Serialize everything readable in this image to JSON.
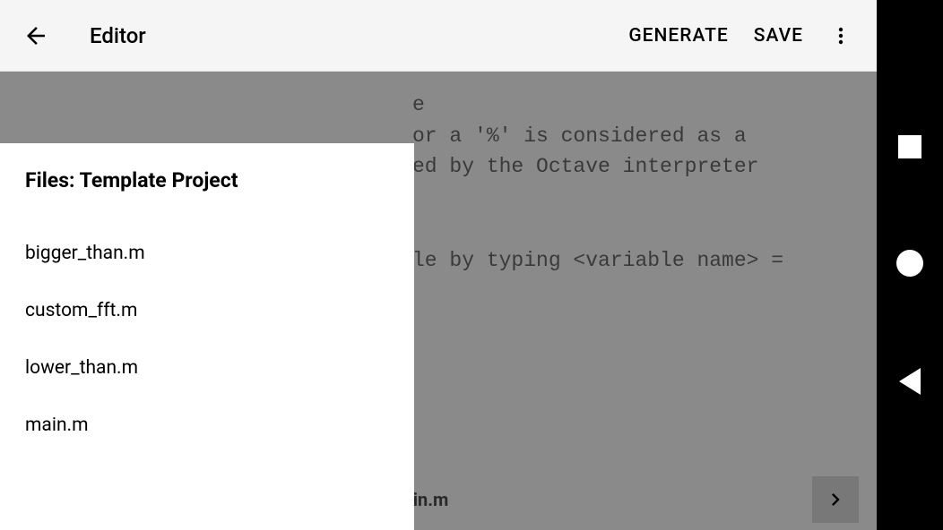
{
  "app_bar": {
    "title": "Editor",
    "actions": {
      "generate": "GENERATE",
      "save": "SAVE"
    }
  },
  "drawer": {
    "title": "Files: Template Project",
    "files": [
      "bigger_than.m",
      "custom_fft.m",
      "lower_than.m",
      "main.m"
    ]
  },
  "editor": {
    "lines": [
      "e",
      "",
      "or a '%' is considered as a",
      "ed by the Octave interpreter",
      "",
      "",
      "",
      "le by typing <variable name> ="
    ],
    "current_file": "ain.m"
  }
}
